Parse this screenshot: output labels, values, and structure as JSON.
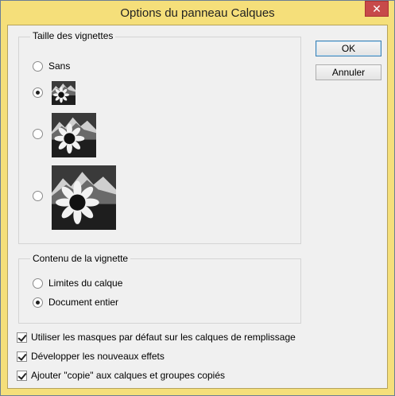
{
  "window": {
    "title": "Options du panneau Calques",
    "close_glyph": "✕"
  },
  "thumbnail_size": {
    "legend": "Taille des vignettes",
    "options": [
      {
        "label": "Sans",
        "checked": false
      },
      {
        "label": "",
        "checked": true,
        "size": "small"
      },
      {
        "label": "",
        "checked": false,
        "size": "medium"
      },
      {
        "label": "",
        "checked": false,
        "size": "large"
      }
    ]
  },
  "thumbnail_content": {
    "legend": "Contenu de la vignette",
    "options": [
      {
        "label": "Limites du calque",
        "checked": false
      },
      {
        "label": "Document entier",
        "checked": true
      }
    ]
  },
  "checkboxes": [
    {
      "label": "Utiliser les masques par défaut sur les calques de remplissage",
      "checked": true
    },
    {
      "label": "Développer les nouveaux effets",
      "checked": true
    },
    {
      "label": "Ajouter \"copie\" aux calques et groupes copiés",
      "checked": true
    }
  ],
  "buttons": {
    "ok": "OK",
    "cancel": "Annuler"
  }
}
